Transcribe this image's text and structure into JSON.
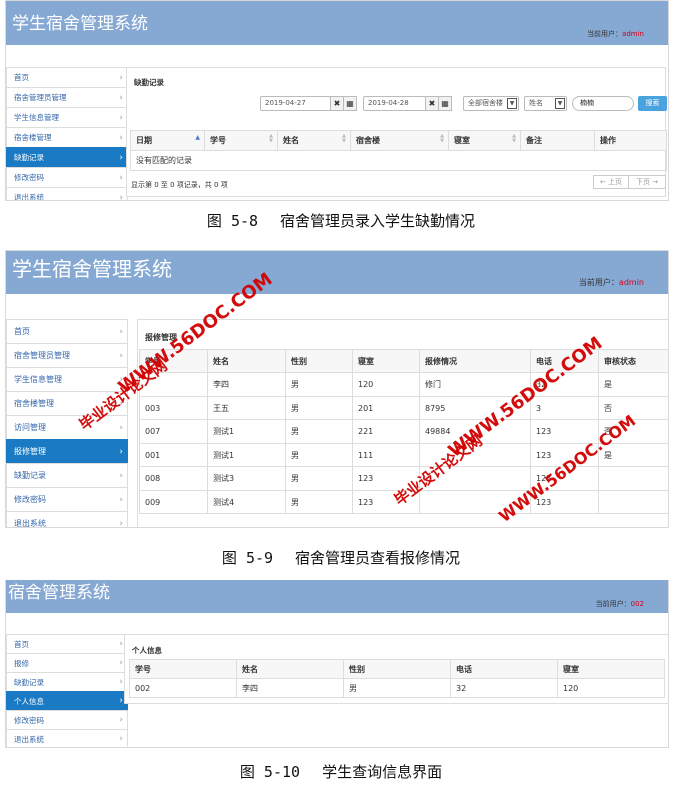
{
  "fig8": {
    "app_title": "学生宿舍管理系统",
    "user_label": "当前用户：",
    "user_name": "admin",
    "menu": [
      {
        "label": "首页"
      },
      {
        "label": "宿舍管理员管理"
      },
      {
        "label": "学生信息管理"
      },
      {
        "label": "宿舍楼管理"
      },
      {
        "label": "缺勤记录",
        "active": true
      },
      {
        "label": "修改密码"
      },
      {
        "label": "退出系统"
      }
    ],
    "panel_title": "缺勤记录",
    "date_from": "2019-04-27",
    "date_to": "2019-04-28",
    "building_select": "全部宿舍楼",
    "field_select": "姓名",
    "search_value": "楠楠",
    "search_button": "搜索",
    "columns": [
      "日期",
      "学号",
      "姓名",
      "宿舍楼",
      "寝室",
      "备注",
      "操作"
    ],
    "empty_text": "没有匹配的记录",
    "footer_text": "显示第 0 至 0 项记录，共 0 项",
    "prev_label": "← 上页",
    "next_label": "下页 →",
    "caption_num": "图 5-8",
    "caption_text": "宿舍管理员录入学生缺勤情况"
  },
  "fig9": {
    "app_title": "学生宿舍管理系统",
    "user_label": "当前用户：",
    "user_name": "admin",
    "menu": [
      {
        "label": "首页"
      },
      {
        "label": "宿舍管理员管理"
      },
      {
        "label": "学生信息管理"
      },
      {
        "label": "宿舍楼管理"
      },
      {
        "label": "访问管理"
      },
      {
        "label": "报修管理",
        "active": true
      },
      {
        "label": "缺勤记录"
      },
      {
        "label": "修改密码"
      },
      {
        "label": "退出系统"
      }
    ],
    "panel_title": "报修管理",
    "columns": [
      "学号",
      "姓名",
      "性别",
      "寝室",
      "报修情况",
      "电话",
      "审核状态"
    ],
    "rows": [
      [
        "",
        "李四",
        "男",
        "120",
        "修门",
        "32",
        "是"
      ],
      [
        "003",
        "王五",
        "男",
        "201",
        "8795",
        "3",
        "否"
      ],
      [
        "007",
        "测试1",
        "男",
        "221",
        "49884",
        "123",
        "否"
      ],
      [
        "001",
        "测试1",
        "男",
        "111",
        "",
        "123",
        "是"
      ],
      [
        "008",
        "测试3",
        "男",
        "123",
        "",
        "123",
        ""
      ],
      [
        "009",
        "测试4",
        "男",
        "123",
        "",
        "123",
        ""
      ]
    ],
    "caption_num": "图 5-9",
    "caption_text": "宿舍管理员查看报修情况"
  },
  "fig10": {
    "app_title": "宿舍管理系统",
    "user_label": "当前用户：",
    "user_name": "002",
    "menu": [
      {
        "label": "首页"
      },
      {
        "label": "报修"
      },
      {
        "label": "缺勤记录"
      },
      {
        "label": "个人信息",
        "active": true
      },
      {
        "label": "修改密码"
      },
      {
        "label": "退出系统"
      }
    ],
    "panel_title": "个人信息",
    "columns": [
      "学号",
      "姓名",
      "性别",
      "电话",
      "寝室"
    ],
    "row": [
      "002",
      "李四",
      "男",
      "32",
      "120"
    ],
    "caption_num": "图 5-10",
    "caption_text": "学生查询信息界面"
  },
  "watermarks": {
    "site": "WWW.56DOC.COM",
    "name": "毕业设计论文网",
    "color": "#d10000"
  },
  "colors": {
    "header": "#86a9d4",
    "active_menu": "#1a7bc4",
    "search_button": "#4aa3df"
  }
}
